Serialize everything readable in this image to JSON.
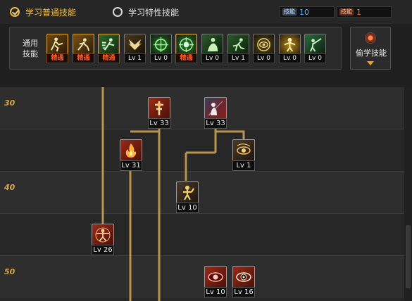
{
  "tabs": {
    "normal_label": "学习普通技能",
    "special_label": "学习特性技能"
  },
  "points": {
    "blue_icon_text": "技能",
    "blue_value": "10",
    "red_icon_text": "技能",
    "red_value": "1"
  },
  "common_skills": {
    "label": "通用技能",
    "items": [
      {
        "icon": "runner-icon",
        "level": "精通",
        "mastered": true
      },
      {
        "icon": "lunge-icon",
        "level": "精通",
        "mastered": true
      },
      {
        "icon": "dash-icon",
        "level": "精通",
        "mastered": true
      },
      {
        "icon": "wings-icon",
        "level": "Lv 1",
        "mastered": false
      },
      {
        "icon": "crosshair-icon",
        "level": "Lv 0",
        "mastered": false
      },
      {
        "icon": "target-icon",
        "level": "精通",
        "mastered": true
      },
      {
        "icon": "kneel-icon",
        "level": "Lv 0",
        "mastered": false
      },
      {
        "icon": "leap-icon",
        "level": "Lv 1",
        "mastered": false
      },
      {
        "icon": "eye-ring-icon",
        "level": "Lv 0",
        "mastered": false
      },
      {
        "icon": "glow-figure-icon",
        "level": "Lv 0",
        "mastered": false
      },
      {
        "icon": "spear-thrust-icon",
        "level": "Lv 0",
        "mastered": false
      }
    ]
  },
  "steal_skill": {
    "label": "偷学技能"
  },
  "tree": {
    "level_markers": [
      "30",
      "40",
      "50"
    ],
    "nodes": [
      {
        "icon": "sword-cross-icon",
        "level": "Lv 33",
        "style": "red"
      },
      {
        "icon": "shadow-figure-icon",
        "level": "Lv 33",
        "style": "mixed"
      },
      {
        "icon": "fire-icon",
        "level": "Lv 31",
        "style": "red"
      },
      {
        "icon": "eye-swirl-icon",
        "level": "Lv 1",
        "style": "dark"
      },
      {
        "icon": "warrior-icon",
        "level": "Lv 10",
        "style": "dark"
      },
      {
        "icon": "vitruvian-icon",
        "level": "Lv 26",
        "style": "red"
      },
      {
        "icon": "red-eye-icon",
        "level": "Lv 10",
        "style": "red"
      },
      {
        "icon": "watching-eye-icon",
        "level": "Lv 16",
        "style": "red"
      }
    ]
  },
  "colors": {
    "accent_gold": "#f0c04a",
    "connector": "#b8954e",
    "mastered_text": "#ff5a28",
    "points_blue": "#4fb0ff",
    "points_red": "#ff6a3a"
  }
}
